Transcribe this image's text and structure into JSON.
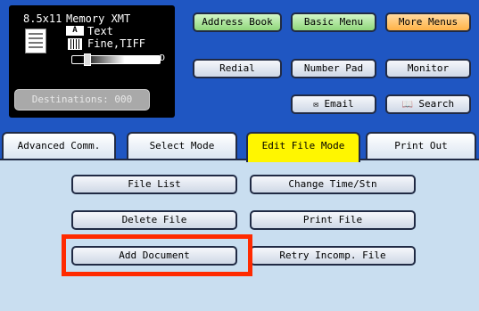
{
  "status": {
    "paper_size": "8.5x11",
    "memory": "Memory XMT",
    "mode_icon": "A",
    "mode": "Text",
    "resolution": "Fine,TIFF",
    "slider_right": "D",
    "destinations": "Destinations: 000"
  },
  "top_buttons": {
    "address_book": "Address Book",
    "basic_menu": "Basic Menu",
    "more_menus": "More Menus",
    "redial": "Redial",
    "number_pad": "Number Pad",
    "monitor": "Monitor",
    "email": "Email",
    "search": "Search"
  },
  "tabs": {
    "advanced": "Advanced Comm.",
    "select_mode": "Select Mode",
    "edit_file_mode": "Edit File Mode",
    "print_out": "Print Out"
  },
  "actions": {
    "file_list": "File List",
    "change_time": "Change Time/Stn",
    "delete_file": "Delete File",
    "print_file": "Print File",
    "add_document": "Add Document",
    "retry": "Retry Incomp. File"
  },
  "colors": {
    "header": "#1f56c2",
    "active_tab": "#fff600",
    "highlight": "#ff2a00"
  }
}
